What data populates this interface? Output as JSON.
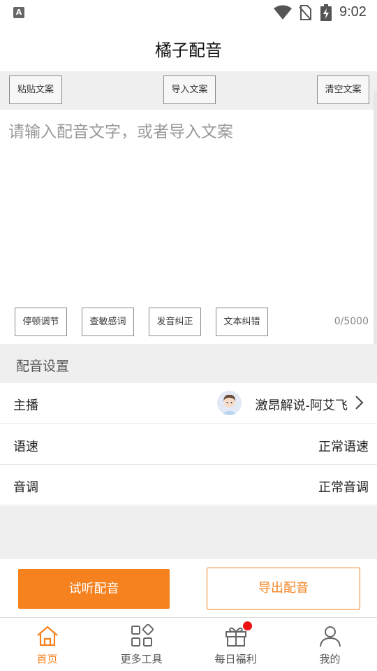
{
  "status_bar": {
    "indicator": "A",
    "time": "9:02",
    "icons": [
      "a-notification-icon",
      "wifi-icon",
      "no-sim-icon",
      "battery-charging-icon"
    ]
  },
  "header": {
    "title": "橘子配音"
  },
  "toolbar": {
    "paste": "粘贴文案",
    "import": "导入文案",
    "clear": "清空文案"
  },
  "editor": {
    "placeholder": "请输入配音文字，或者导入文案",
    "value": "",
    "buttons": [
      "停顿调节",
      "查敏感词",
      "发音纠正",
      "文本纠错"
    ],
    "char_count": "0/5000"
  },
  "settings": {
    "title": "配音设置",
    "rows": [
      {
        "label": "主播",
        "value": "激昂解说-阿艾飞"
      },
      {
        "label": "语速",
        "value": "正常语速"
      },
      {
        "label": "音调",
        "value": "正常音调"
      }
    ]
  },
  "actions": {
    "listen": "试听配音",
    "export": "导出配音"
  },
  "bottom_nav": {
    "items": [
      {
        "label": "首页",
        "icon": "home-icon",
        "active": true
      },
      {
        "label": "更多工具",
        "icon": "grid-icon",
        "active": false
      },
      {
        "label": "每日福利",
        "icon": "gift-icon",
        "active": false,
        "badge": true
      },
      {
        "label": "我的",
        "icon": "user-icon",
        "active": false
      }
    ]
  },
  "colors": {
    "accent": "#f5821f",
    "badge": "#ee1111",
    "section_bg": "#efefef"
  }
}
